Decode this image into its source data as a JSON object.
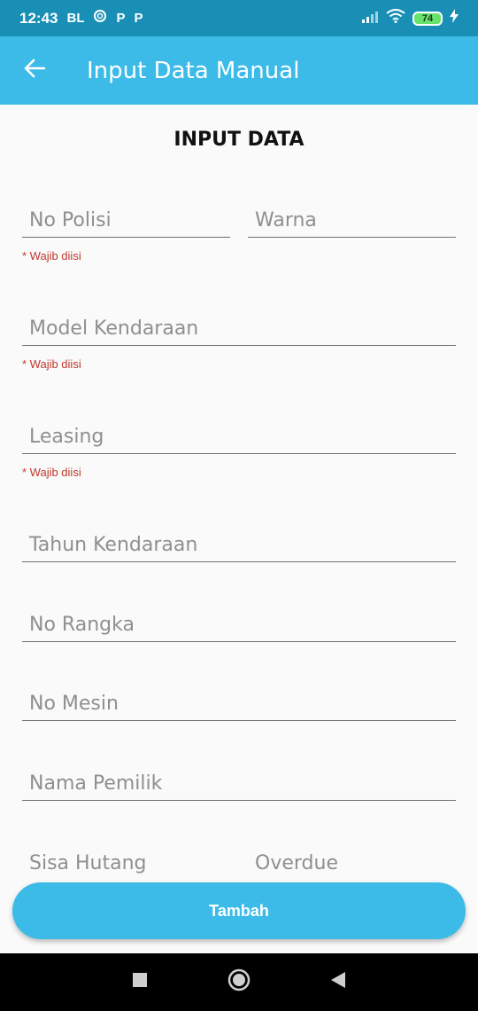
{
  "status_bar": {
    "time": "12:43",
    "carrier": "BL",
    "app_icon_1": "P",
    "app_icon_2": "P",
    "battery": "74"
  },
  "app_bar": {
    "title": "Input Data Manual",
    "back_icon": "arrow-back-icon"
  },
  "form": {
    "heading": "INPUT DATA",
    "fields": {
      "no_polisi": "No Polisi",
      "warna": "Warna",
      "model_kendaraan": "Model Kendaraan",
      "leasing": "Leasing",
      "tahun_kendaraan": "Tahun Kendaraan",
      "no_rangka": "No Rangka",
      "no_mesin": "No Mesin",
      "nama_pemilik": "Nama Pemilik",
      "sisa_hutang": "Sisa Hutang",
      "overdue": "Overdue"
    },
    "required_note": "* Wajib diisi"
  },
  "actions": {
    "submit_label": "Tambah"
  },
  "colors": {
    "status_bar": "#1a8fb6",
    "app_bar": "#3dbbe8",
    "button": "#3dbbe8",
    "required": "#c0392b"
  }
}
